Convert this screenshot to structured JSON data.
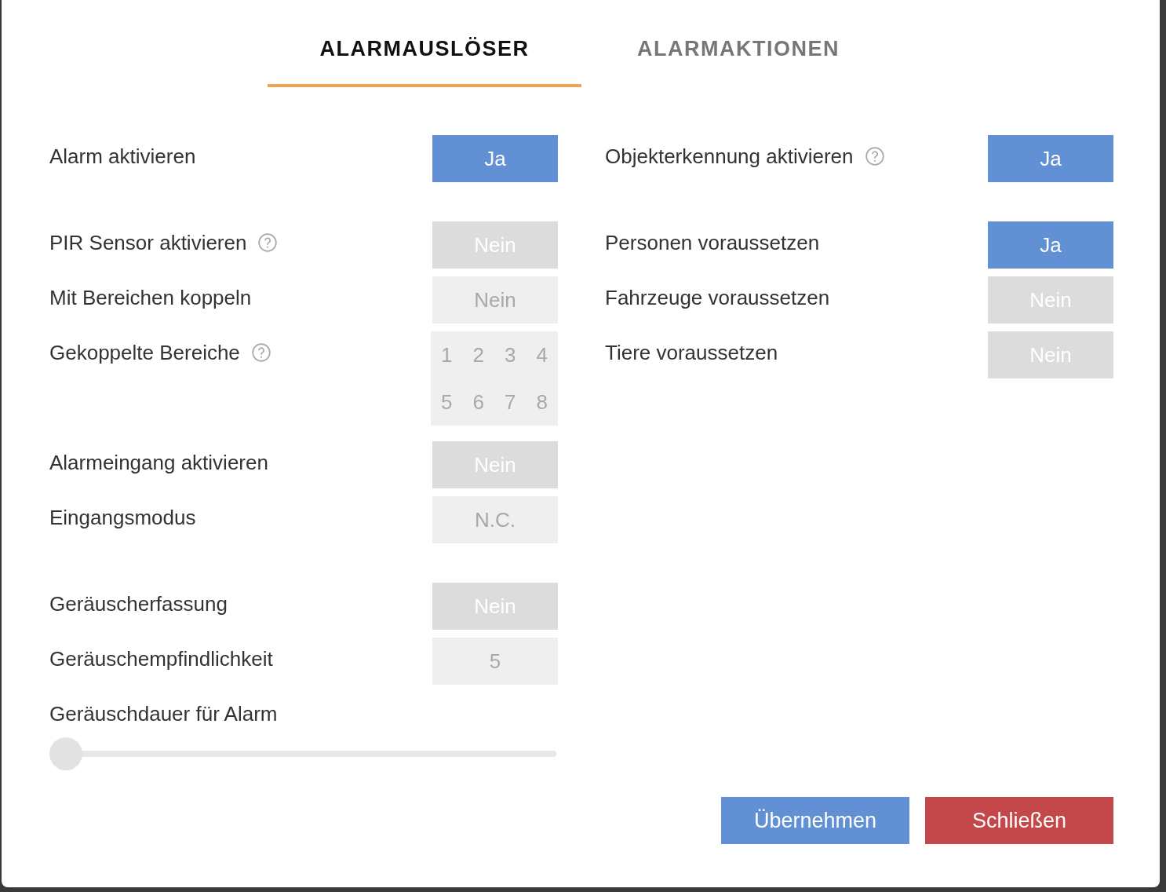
{
  "tabs": [
    {
      "label": "ALARMAUSLÖSER",
      "selected": true
    },
    {
      "label": "ALARMAKTIONEN",
      "selected": false
    }
  ],
  "left_groups": [
    [
      {
        "kind": "toggle",
        "label": "Alarm aktivieren",
        "help": false,
        "value": "Ja",
        "on": true,
        "disabled": false
      }
    ],
    [
      {
        "kind": "toggle",
        "label": "PIR Sensor aktivieren",
        "help": true,
        "value": "Nein",
        "on": false,
        "disabled": false
      },
      {
        "kind": "toggle",
        "label": "Mit Bereichen koppeln",
        "help": false,
        "value": "Nein",
        "on": false,
        "disabled": true
      },
      {
        "kind": "zones",
        "label": "Gekoppelte Bereiche",
        "help": true,
        "zones": [
          "1",
          "2",
          "3",
          "4",
          "5",
          "6",
          "7",
          "8"
        ],
        "disabled": true
      },
      {
        "kind": "toggle",
        "label": "Alarmeingang aktivieren",
        "help": false,
        "value": "Nein",
        "on": false,
        "disabled": false
      },
      {
        "kind": "select",
        "label": "Eingangsmodus",
        "help": false,
        "value": "N.C.",
        "disabled": true
      }
    ],
    [
      {
        "kind": "toggle",
        "label": "Geräuscherfassung",
        "help": false,
        "value": "Nein",
        "on": false,
        "disabled": false
      },
      {
        "kind": "number",
        "label": "Geräuschempfindlichkeit",
        "help": false,
        "value": "5",
        "disabled": true
      },
      {
        "kind": "slider",
        "label": "Geräuschdauer für Alarm",
        "help": false,
        "level": 0
      }
    ]
  ],
  "right_groups": [
    [
      {
        "kind": "toggle",
        "label": "Objekterkennung aktivieren",
        "help": true,
        "value": "Ja",
        "on": true,
        "disabled": false
      }
    ],
    [
      {
        "kind": "toggle",
        "label": "Personen voraussetzen",
        "help": false,
        "value": "Ja",
        "on": true,
        "disabled": false
      },
      {
        "kind": "toggle",
        "label": "Fahrzeuge voraussetzen",
        "help": false,
        "value": "Nein",
        "on": false,
        "disabled": false
      },
      {
        "kind": "toggle",
        "label": "Tiere voraussetzen",
        "help": false,
        "value": "Nein",
        "on": false,
        "disabled": false
      }
    ]
  ],
  "buttons": [
    {
      "label": "Übernehmen",
      "kind": "primary"
    },
    {
      "label": "Schließen",
      "kind": "danger"
    }
  ]
}
